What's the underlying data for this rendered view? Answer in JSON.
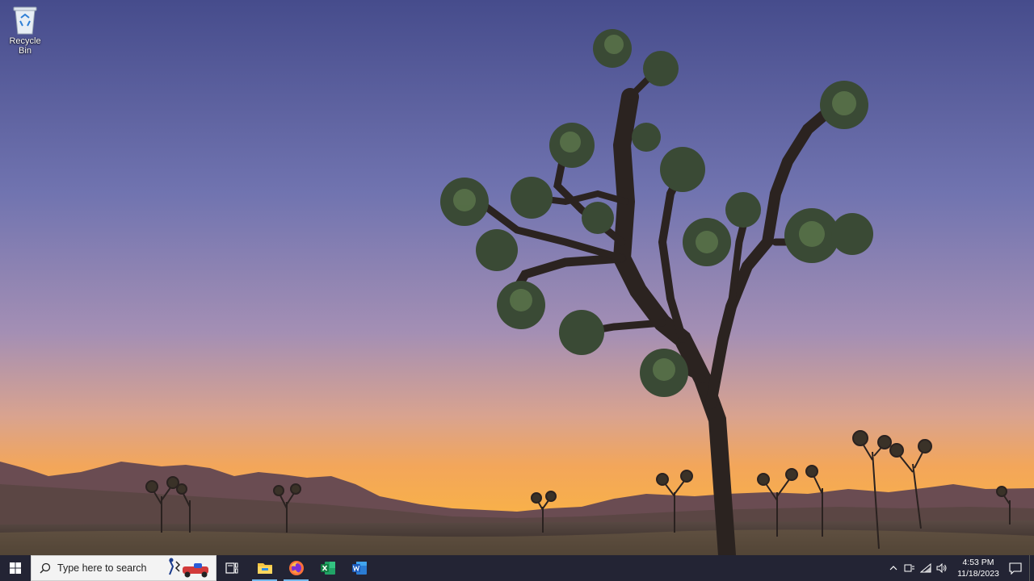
{
  "desktop": {
    "icons": [
      {
        "label": "Recycle Bin",
        "icon": "recycle-bin-icon"
      }
    ]
  },
  "taskbar": {
    "start": {
      "icon": "windows-logo-icon"
    },
    "search": {
      "placeholder": "Type here to search",
      "icon": "search-icon"
    },
    "task_view": {
      "icon": "task-view-icon"
    },
    "apps": [
      {
        "name": "File Explorer",
        "icon": "file-explorer-icon",
        "running": true
      },
      {
        "name": "Firefox",
        "icon": "firefox-icon",
        "running": true
      },
      {
        "name": "Excel",
        "icon": "excel-icon",
        "running": false
      },
      {
        "name": "Word",
        "icon": "word-icon",
        "running": false
      }
    ],
    "tray": {
      "icons": [
        "chevron-up-icon",
        "input-method-icon",
        "network-icon",
        "volume-icon"
      ],
      "time": "4:53 PM",
      "date": "11/18/2023"
    },
    "notification": {
      "icon": "action-center-icon"
    }
  },
  "colors": {
    "taskbar": "#232434",
    "accent": "#76b9ed",
    "sky_top": "#4a4f8e",
    "sky_horizon": "#f5a64a"
  }
}
